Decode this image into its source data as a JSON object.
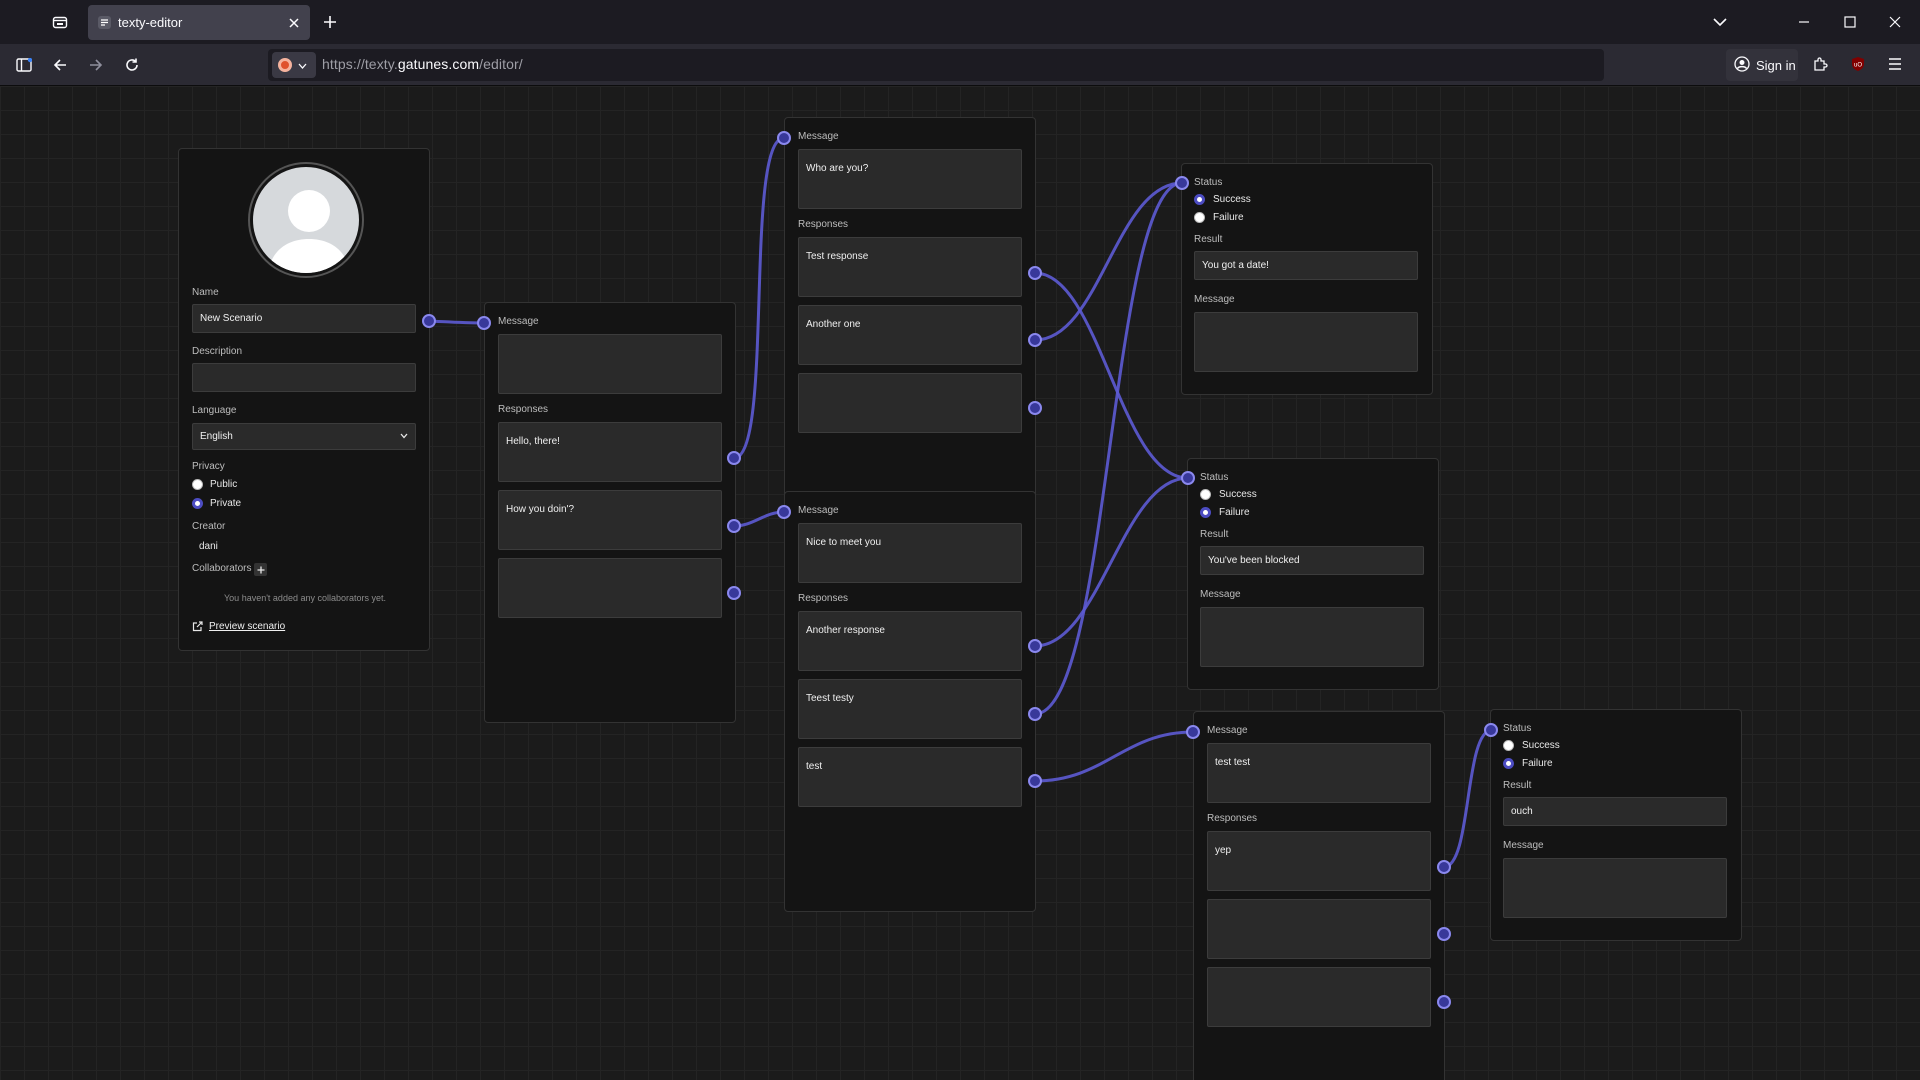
{
  "browser": {
    "tab_title": "texty-editor",
    "url_prefix": "https://texty.",
    "url_host": "gatunes.com",
    "url_path": "/editor/",
    "sign_in_label": "Sign in",
    "accent": "#8a88ee"
  },
  "scenario": {
    "name_label": "Name",
    "name_value": "New Scenario",
    "description_label": "Description",
    "description_value": "",
    "language_label": "Language",
    "language_value": "English",
    "privacy_label": "Privacy",
    "privacy_options": [
      "Public",
      "Private"
    ],
    "privacy_selected": "Private",
    "creator_label": "Creator",
    "creator_value": "dani",
    "collaborators_label": "Collaborators",
    "collaborators_empty": "You haven't added any collaborators yet.",
    "preview_label": "Preview scenario"
  },
  "labels": {
    "message": "Message",
    "responses": "Responses",
    "status": "Status",
    "success": "Success",
    "failure": "Failure",
    "result": "Result"
  },
  "message_nodes": [
    {
      "message": "",
      "responses": [
        "Hello, there!",
        "How you doin'?",
        ""
      ]
    },
    {
      "message": "Who are you?",
      "responses": [
        "Test response",
        "Another one",
        ""
      ]
    },
    {
      "message": "Nice to meet you",
      "responses": [
        "Another response",
        "Teest testy",
        "test"
      ]
    },
    {
      "message": "test test",
      "responses": [
        "yep",
        "",
        ""
      ]
    }
  ],
  "status_nodes": [
    {
      "selected": "Success",
      "result": "You got a date!",
      "message": ""
    },
    {
      "selected": "Failure",
      "result": "You've been blocked",
      "message": ""
    },
    {
      "selected": "Failure",
      "result": "ouch",
      "message": ""
    }
  ]
}
